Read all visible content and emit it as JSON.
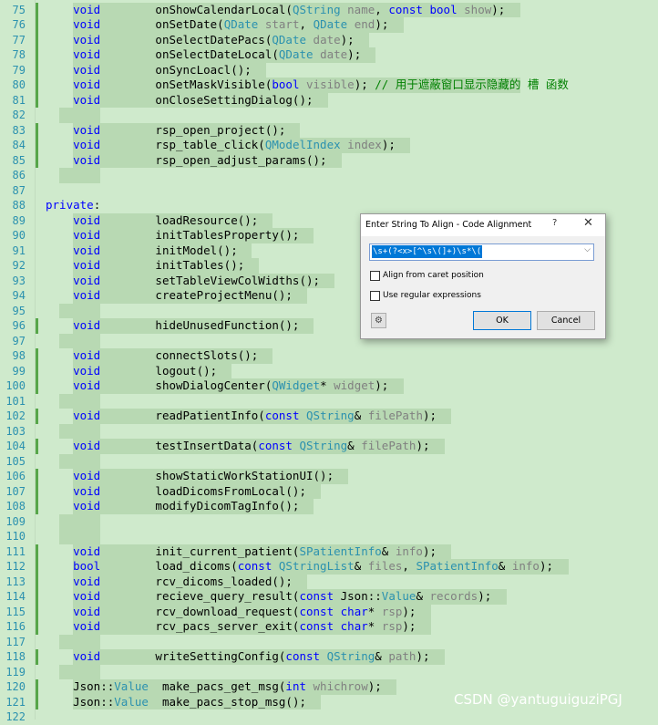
{
  "colors": {
    "background": "#cfeacc",
    "line_number": "#2b91af",
    "keyword": "#0000ff",
    "type": "#2b91af",
    "param": "#808080",
    "comment": "#008000",
    "change_marker": "#57a64a"
  },
  "lines": [
    {
      "n": "75",
      "mark": true,
      "hl": true,
      "tokens": [
        {
          "t": "    "
        },
        {
          "t": "void",
          "c": "kw"
        },
        {
          "t": "        onShowCalendarLocal("
        },
        {
          "t": "QString",
          "c": "ty"
        },
        {
          "t": " "
        },
        {
          "t": "name",
          "c": "pm"
        },
        {
          "t": ", "
        },
        {
          "t": "const",
          "c": "kw"
        },
        {
          "t": " "
        },
        {
          "t": "bool",
          "c": "kw"
        },
        {
          "t": " "
        },
        {
          "t": "show",
          "c": "pm"
        },
        {
          "t": ");"
        }
      ]
    },
    {
      "n": "76",
      "mark": true,
      "hl": true,
      "tokens": [
        {
          "t": "    "
        },
        {
          "t": "void",
          "c": "kw"
        },
        {
          "t": "        onSetDate("
        },
        {
          "t": "QDate",
          "c": "ty"
        },
        {
          "t": " "
        },
        {
          "t": "start",
          "c": "pm"
        },
        {
          "t": ", "
        },
        {
          "t": "QDate",
          "c": "ty"
        },
        {
          "t": " "
        },
        {
          "t": "end",
          "c": "pm"
        },
        {
          "t": ");"
        }
      ]
    },
    {
      "n": "77",
      "mark": true,
      "hl": true,
      "tokens": [
        {
          "t": "    "
        },
        {
          "t": "void",
          "c": "kw"
        },
        {
          "t": "        onSelectDatePacs("
        },
        {
          "t": "QDate",
          "c": "ty"
        },
        {
          "t": " "
        },
        {
          "t": "date",
          "c": "pm"
        },
        {
          "t": ");"
        }
      ]
    },
    {
      "n": "78",
      "mark": true,
      "hl": true,
      "tokens": [
        {
          "t": "    "
        },
        {
          "t": "void",
          "c": "kw"
        },
        {
          "t": "        onSelectDateLocal("
        },
        {
          "t": "QDate",
          "c": "ty"
        },
        {
          "t": " "
        },
        {
          "t": "date",
          "c": "pm"
        },
        {
          "t": ");"
        }
      ]
    },
    {
      "n": "79",
      "mark": true,
      "hl": true,
      "tokens": [
        {
          "t": "    "
        },
        {
          "t": "void",
          "c": "kw"
        },
        {
          "t": "        onSyncLoacl();"
        }
      ]
    },
    {
      "n": "80",
      "mark": true,
      "hl": true,
      "tokens": [
        {
          "t": "    "
        },
        {
          "t": "void",
          "c": "kw"
        },
        {
          "t": "        onSetMaskVisible("
        },
        {
          "t": "bool",
          "c": "kw"
        },
        {
          "t": " "
        },
        {
          "t": "visible",
          "c": "pm"
        },
        {
          "t": "); "
        },
        {
          "t": "// 用于遮蔽窗口显示隐藏的 槽 函数",
          "c": "cm"
        }
      ]
    },
    {
      "n": "81",
      "mark": true,
      "hl": true,
      "tokens": [
        {
          "t": "    "
        },
        {
          "t": "void",
          "c": "kw"
        },
        {
          "t": "        onCloseSettingDialog();"
        }
      ]
    },
    {
      "n": "82",
      "mark": false,
      "hl": true,
      "tokens": []
    },
    {
      "n": "83",
      "mark": true,
      "hl": true,
      "tokens": [
        {
          "t": "    "
        },
        {
          "t": "void",
          "c": "kw"
        },
        {
          "t": "        rsp_open_project();"
        }
      ]
    },
    {
      "n": "84",
      "mark": true,
      "hl": true,
      "tokens": [
        {
          "t": "    "
        },
        {
          "t": "void",
          "c": "kw"
        },
        {
          "t": "        rsp_table_click("
        },
        {
          "t": "QModelIndex",
          "c": "ty"
        },
        {
          "t": " "
        },
        {
          "t": "index",
          "c": "pm"
        },
        {
          "t": ");"
        }
      ]
    },
    {
      "n": "85",
      "mark": true,
      "hl": true,
      "tokens": [
        {
          "t": "    "
        },
        {
          "t": "void",
          "c": "kw"
        },
        {
          "t": "        rsp_open_adjust_params();"
        }
      ]
    },
    {
      "n": "86",
      "mark": false,
      "hl": true,
      "tokens": []
    },
    {
      "n": "87",
      "mark": false,
      "hl": false,
      "tokens": []
    },
    {
      "n": "88",
      "mark": false,
      "hl": false,
      "tokens": [
        {
          "t": "private",
          "c": "kw"
        },
        {
          "t": ":"
        }
      ]
    },
    {
      "n": "89",
      "mark": false,
      "hl": true,
      "tokens": [
        {
          "t": "    "
        },
        {
          "t": "void",
          "c": "kw"
        },
        {
          "t": "        loadResource();"
        }
      ]
    },
    {
      "n": "90",
      "mark": false,
      "hl": true,
      "tokens": [
        {
          "t": "    "
        },
        {
          "t": "void",
          "c": "kw"
        },
        {
          "t": "        initTablesProperty();"
        }
      ]
    },
    {
      "n": "91",
      "mark": false,
      "hl": true,
      "tokens": [
        {
          "t": "    "
        },
        {
          "t": "void",
          "c": "kw"
        },
        {
          "t": "        initModel();"
        }
      ]
    },
    {
      "n": "92",
      "mark": false,
      "hl": true,
      "tokens": [
        {
          "t": "    "
        },
        {
          "t": "void",
          "c": "kw"
        },
        {
          "t": "        initTables();"
        }
      ]
    },
    {
      "n": "93",
      "mark": false,
      "hl": true,
      "tokens": [
        {
          "t": "    "
        },
        {
          "t": "void",
          "c": "kw"
        },
        {
          "t": "        setTableViewColWidths();"
        }
      ]
    },
    {
      "n": "94",
      "mark": false,
      "hl": true,
      "tokens": [
        {
          "t": "    "
        },
        {
          "t": "void",
          "c": "kw"
        },
        {
          "t": "        createProjectMenu();"
        }
      ]
    },
    {
      "n": "95",
      "mark": false,
      "hl": true,
      "tokens": []
    },
    {
      "n": "96",
      "mark": true,
      "hl": true,
      "tokens": [
        {
          "t": "    "
        },
        {
          "t": "void",
          "c": "kw"
        },
        {
          "t": "        hideUnusedFunction();"
        }
      ]
    },
    {
      "n": "97",
      "mark": false,
      "hl": true,
      "tokens": []
    },
    {
      "n": "98",
      "mark": true,
      "hl": true,
      "tokens": [
        {
          "t": "    "
        },
        {
          "t": "void",
          "c": "kw"
        },
        {
          "t": "        connectSlots();"
        }
      ]
    },
    {
      "n": "99",
      "mark": true,
      "hl": true,
      "tokens": [
        {
          "t": "    "
        },
        {
          "t": "void",
          "c": "kw"
        },
        {
          "t": "        logout();"
        }
      ]
    },
    {
      "n": "100",
      "mark": true,
      "hl": true,
      "tokens": [
        {
          "t": "    "
        },
        {
          "t": "void",
          "c": "kw"
        },
        {
          "t": "        showDialogCenter("
        },
        {
          "t": "QWidget",
          "c": "ty"
        },
        {
          "t": "* "
        },
        {
          "t": "widget",
          "c": "pm"
        },
        {
          "t": ");"
        }
      ]
    },
    {
      "n": "101",
      "mark": false,
      "hl": true,
      "tokens": []
    },
    {
      "n": "102",
      "mark": true,
      "hl": true,
      "tokens": [
        {
          "t": "    "
        },
        {
          "t": "void",
          "c": "kw"
        },
        {
          "t": "        readPatientInfo("
        },
        {
          "t": "const",
          "c": "kw"
        },
        {
          "t": " "
        },
        {
          "t": "QString",
          "c": "ty"
        },
        {
          "t": "& "
        },
        {
          "t": "filePath",
          "c": "pm"
        },
        {
          "t": ");"
        }
      ]
    },
    {
      "n": "103",
      "mark": false,
      "hl": true,
      "tokens": []
    },
    {
      "n": "104",
      "mark": true,
      "hl": true,
      "tokens": [
        {
          "t": "    "
        },
        {
          "t": "void",
          "c": "kw"
        },
        {
          "t": "        testInsertData("
        },
        {
          "t": "const",
          "c": "kw"
        },
        {
          "t": " "
        },
        {
          "t": "QString",
          "c": "ty"
        },
        {
          "t": "& "
        },
        {
          "t": "filePath",
          "c": "pm"
        },
        {
          "t": ");"
        }
      ]
    },
    {
      "n": "105",
      "mark": false,
      "hl": true,
      "tokens": []
    },
    {
      "n": "106",
      "mark": true,
      "hl": true,
      "tokens": [
        {
          "t": "    "
        },
        {
          "t": "void",
          "c": "kw"
        },
        {
          "t": "        showStaticWorkStationUI();"
        }
      ]
    },
    {
      "n": "107",
      "mark": true,
      "hl": true,
      "tokens": [
        {
          "t": "    "
        },
        {
          "t": "void",
          "c": "kw"
        },
        {
          "t": "        loadDicomsFromLocal();"
        }
      ]
    },
    {
      "n": "108",
      "mark": true,
      "hl": true,
      "tokens": [
        {
          "t": "    "
        },
        {
          "t": "void",
          "c": "kw"
        },
        {
          "t": "        modifyDicomTagInfo();"
        }
      ]
    },
    {
      "n": "109",
      "mark": false,
      "hl": true,
      "tokens": []
    },
    {
      "n": "110",
      "mark": false,
      "hl": true,
      "tokens": []
    },
    {
      "n": "111",
      "mark": true,
      "hl": true,
      "tokens": [
        {
          "t": "    "
        },
        {
          "t": "void",
          "c": "kw"
        },
        {
          "t": "        init_current_patient("
        },
        {
          "t": "SPatientInfo",
          "c": "ty"
        },
        {
          "t": "& "
        },
        {
          "t": "info",
          "c": "pm"
        },
        {
          "t": ");"
        }
      ]
    },
    {
      "n": "112",
      "mark": true,
      "hl": true,
      "tokens": [
        {
          "t": "    "
        },
        {
          "t": "bool",
          "c": "kw"
        },
        {
          "t": "        load_dicoms("
        },
        {
          "t": "const",
          "c": "kw"
        },
        {
          "t": " "
        },
        {
          "t": "QStringList",
          "c": "ty"
        },
        {
          "t": "& "
        },
        {
          "t": "files",
          "c": "pm"
        },
        {
          "t": ", "
        },
        {
          "t": "SPatientInfo",
          "c": "ty"
        },
        {
          "t": "& "
        },
        {
          "t": "info",
          "c": "pm"
        },
        {
          "t": ");"
        }
      ]
    },
    {
      "n": "113",
      "mark": true,
      "hl": true,
      "tokens": [
        {
          "t": "    "
        },
        {
          "t": "void",
          "c": "kw"
        },
        {
          "t": "        rcv_dicoms_loaded();"
        }
      ]
    },
    {
      "n": "114",
      "mark": true,
      "hl": true,
      "tokens": [
        {
          "t": "    "
        },
        {
          "t": "void",
          "c": "kw"
        },
        {
          "t": "        recieve_query_result("
        },
        {
          "t": "const",
          "c": "kw"
        },
        {
          "t": " Json::"
        },
        {
          "t": "Value",
          "c": "ty"
        },
        {
          "t": "& "
        },
        {
          "t": "records",
          "c": "pm"
        },
        {
          "t": ");"
        }
      ]
    },
    {
      "n": "115",
      "mark": true,
      "hl": true,
      "tokens": [
        {
          "t": "    "
        },
        {
          "t": "void",
          "c": "kw"
        },
        {
          "t": "        rcv_download_request("
        },
        {
          "t": "const",
          "c": "kw"
        },
        {
          "t": " "
        },
        {
          "t": "char",
          "c": "kw"
        },
        {
          "t": "* "
        },
        {
          "t": "rsp",
          "c": "pm"
        },
        {
          "t": ");"
        }
      ]
    },
    {
      "n": "116",
      "mark": true,
      "hl": true,
      "tokens": [
        {
          "t": "    "
        },
        {
          "t": "void",
          "c": "kw"
        },
        {
          "t": "        rcv_pacs_server_exit("
        },
        {
          "t": "const",
          "c": "kw"
        },
        {
          "t": " "
        },
        {
          "t": "char",
          "c": "kw"
        },
        {
          "t": "* "
        },
        {
          "t": "rsp",
          "c": "pm"
        },
        {
          "t": ");"
        }
      ]
    },
    {
      "n": "117",
      "mark": false,
      "hl": true,
      "tokens": []
    },
    {
      "n": "118",
      "mark": true,
      "hl": true,
      "tokens": [
        {
          "t": "    "
        },
        {
          "t": "void",
          "c": "kw"
        },
        {
          "t": "        writeSettingConfig("
        },
        {
          "t": "const",
          "c": "kw"
        },
        {
          "t": " "
        },
        {
          "t": "QString",
          "c": "ty"
        },
        {
          "t": "& "
        },
        {
          "t": "path",
          "c": "pm"
        },
        {
          "t": ");"
        }
      ]
    },
    {
      "n": "119",
      "mark": false,
      "hl": true,
      "tokens": []
    },
    {
      "n": "120",
      "mark": true,
      "hl": true,
      "tokens": [
        {
          "t": "    Json::"
        },
        {
          "t": "Value",
          "c": "ty"
        },
        {
          "t": "  make_pacs_get_msg("
        },
        {
          "t": "int",
          "c": "kw"
        },
        {
          "t": " "
        },
        {
          "t": "whichrow",
          "c": "pm"
        },
        {
          "t": ");"
        }
      ]
    },
    {
      "n": "121",
      "mark": true,
      "hl": true,
      "tokens": [
        {
          "t": "    Json::"
        },
        {
          "t": "Value",
          "c": "ty"
        },
        {
          "t": "  make_pacs_stop_msg();"
        }
      ]
    },
    {
      "n": "122",
      "mark": false,
      "hl": false,
      "tokens": []
    }
  ],
  "dialog": {
    "title": "Enter String To Align - Code Alignment",
    "help": "?",
    "close": "✕",
    "input_value": "\\s+(?<x>[^\\s\\(]+)\\s*\\(",
    "dropdown": "⌵",
    "checkboxes": [
      {
        "label": "Align from caret position",
        "checked": false
      },
      {
        "label": "Use regular expressions",
        "checked": false
      }
    ],
    "options_icon": "gear-icon",
    "ok": "OK",
    "cancel": "Cancel"
  },
  "watermark": "CSDN @yantuguiguziPGJ"
}
